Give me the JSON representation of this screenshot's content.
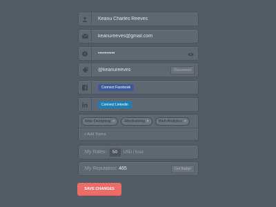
{
  "fields": {
    "name": "Keanu Charles Reeves",
    "email": "keanureeves@gmail.com",
    "password": "••••••••••",
    "twitter": "@keanureeves",
    "twitter_action": "Disconnect",
    "facebook_action": "Connect Facebook",
    "linkedin_action": "Connect Linkedin"
  },
  "topics": {
    "tags": [
      "Web Designing",
      "Wireframing",
      "Web Analytics"
    ],
    "remove_glyph": "×",
    "add_label": "+ Add Topics"
  },
  "rate": {
    "label": "My Rates:",
    "value": "50",
    "unit": "USD / hour"
  },
  "reputation": {
    "label": "My Reputation:",
    "value": "465",
    "action": "Get Badge"
  },
  "save_label": "SAVE CHANGES",
  "colors": {
    "background": "#525c67",
    "field": "#5e6873",
    "facebook": "#3b5b98",
    "linkedin": "#1c7fb6",
    "save": "#ec6c69"
  },
  "icons": {
    "name": "user-icon",
    "email": "envelope-icon",
    "password": "lock-icon",
    "password_toggle": "eye-icon",
    "twitter": "tag-icon",
    "facebook": "facebook-icon",
    "linkedin": "linkedin-icon"
  }
}
